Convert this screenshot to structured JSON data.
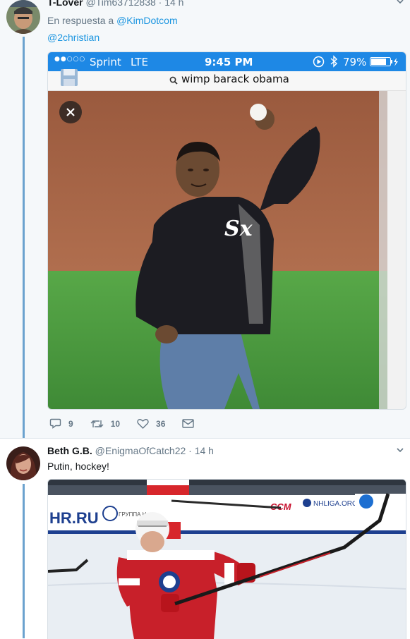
{
  "tweet1": {
    "name": "T-Lover",
    "handle": "@Tim63712838",
    "time": "· 14 h",
    "reply_prefix": "En respuesta a",
    "reply_to": "@KimDotcom",
    "mention": "@2christian",
    "status_bar": {
      "carrier": "Sprint",
      "network": "LTE",
      "time": "9:45 PM",
      "battery": "79%"
    },
    "search_query": "wimp barack obama",
    "actions": {
      "replies": "9",
      "retweets": "10",
      "likes": "36"
    }
  },
  "tweet2": {
    "name": "Beth G.B.",
    "handle": "@EnigmaOfCatch22",
    "time": "· 14 h",
    "text": "Putin, hockey!",
    "rink_signs": [
      "HR.RU",
      "CCM",
      "NHLIGA.ORG",
      "ГРУППА НМЛ"
    ]
  },
  "colors": {
    "accent": "#1b95e0",
    "thread": "#6ba2ce",
    "ios_bar": "#1e88e5"
  }
}
